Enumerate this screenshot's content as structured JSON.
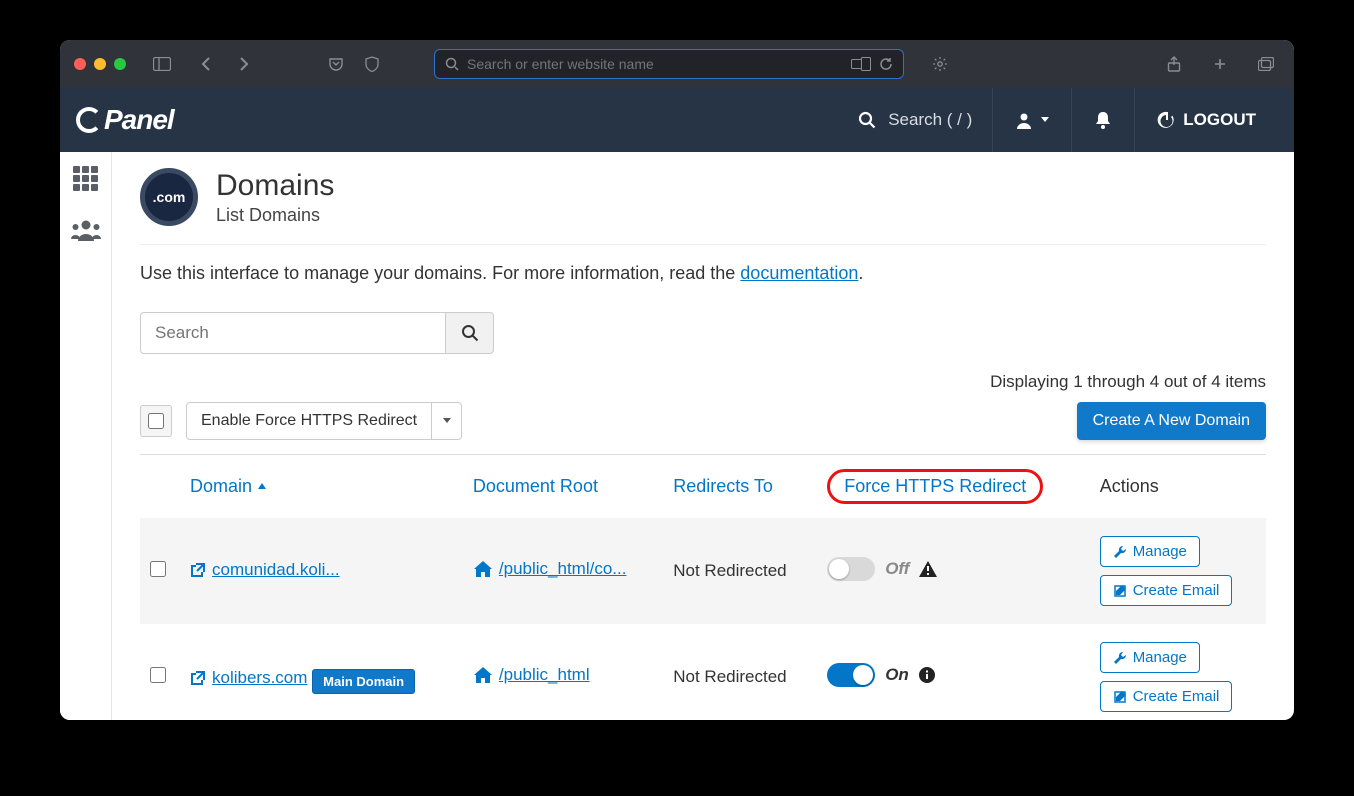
{
  "browser": {
    "url_placeholder": "Search or enter website name"
  },
  "header": {
    "logo_text": "Panel",
    "search_label": "Search ( / )",
    "logout_label": "LOGOUT"
  },
  "page": {
    "icon_label": ".com",
    "title": "Domains",
    "subtitle": "List Domains",
    "intro_prefix": "Use this interface to manage your domains. For more information, read the ",
    "intro_link": "documentation",
    "intro_suffix": "."
  },
  "search": {
    "placeholder": "Search"
  },
  "status_line": "Displaying 1 through 4 out of 4 items",
  "bulk": {
    "combo_label": "Enable Force HTTPS Redirect",
    "create_button": "Create A New Domain"
  },
  "columns": {
    "domain": "Domain",
    "docroot": "Document Root",
    "redirects": "Redirects To",
    "force_https": "Force HTTPS Redirect",
    "actions": "Actions"
  },
  "toggle_labels": {
    "off": "Off",
    "on": "On"
  },
  "action_labels": {
    "manage": "Manage",
    "create_email": "Create Email"
  },
  "main_domain_badge": "Main Domain",
  "rows": [
    {
      "domain": "comunidad.koli...",
      "docroot": "/public_html/co...",
      "redirects": "Not Redirected",
      "https_on": false,
      "is_main": false
    },
    {
      "domain": "kolibers.com",
      "docroot": "/public_html",
      "redirects": "Not Redirected",
      "https_on": true,
      "is_main": true
    }
  ]
}
